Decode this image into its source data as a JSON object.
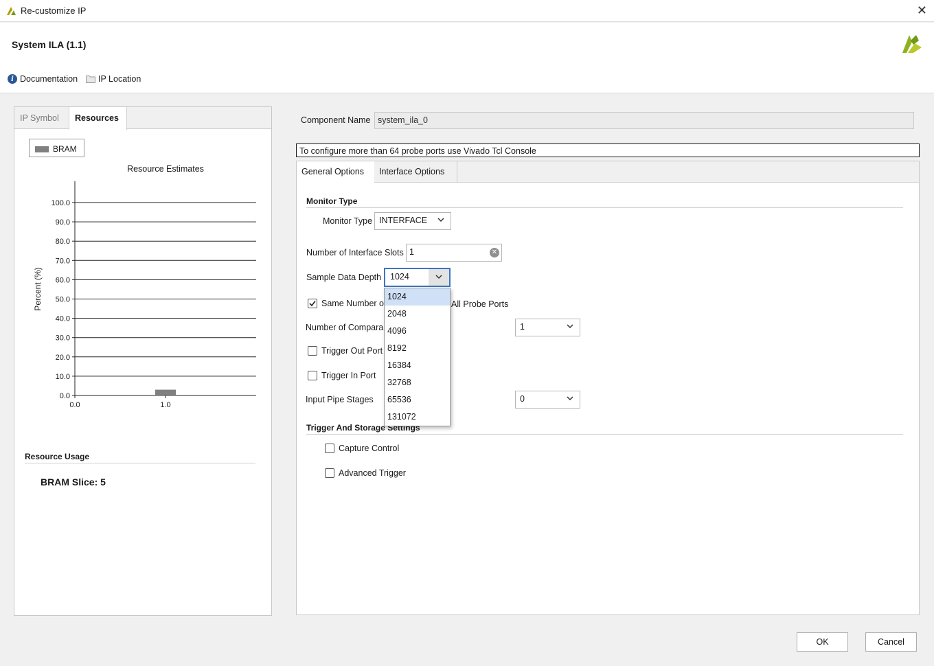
{
  "window": {
    "title": "Re-customize IP",
    "close_glyph": "✕"
  },
  "header": {
    "ip_title": "System ILA (1.1)",
    "links": [
      {
        "label": "Documentation",
        "icon": "info-icon"
      },
      {
        "label": "IP Location",
        "icon": "folder-icon"
      }
    ]
  },
  "left_panel": {
    "tabs": [
      {
        "label": "IP Symbol",
        "active": false
      },
      {
        "label": "Resources",
        "active": true
      }
    ],
    "legend": {
      "label": "BRAM",
      "color": "#808080"
    },
    "resource_usage": {
      "title": "Resource Usage",
      "items": [
        "BRAM Slice: 5"
      ]
    }
  },
  "chart_data": {
    "type": "bar",
    "title": "Resource Estimates",
    "ylabel": "Percent (%)",
    "xlabel": "",
    "categories": [
      "1.0"
    ],
    "series": [
      {
        "name": "BRAM",
        "x": [
          1.0
        ],
        "values": [
          3.0
        ],
        "color": "#808080"
      }
    ],
    "xlim": [
      0.0,
      2.0
    ],
    "ylim": [
      0.0,
      100.0
    ],
    "xticks": [
      "0.0",
      "1.0"
    ],
    "yticks": [
      "0.0",
      "10.0",
      "20.0",
      "30.0",
      "40.0",
      "50.0",
      "60.0",
      "70.0",
      "80.0",
      "90.0",
      "100.0"
    ],
    "grid": true,
    "legend": "top-left"
  },
  "component": {
    "label": "Component Name",
    "value": "system_ila_0"
  },
  "notice": "To configure more than 64 probe ports use Vivado Tcl Console",
  "right_panel": {
    "tabs": [
      {
        "label": "General Options",
        "active": true
      },
      {
        "label": "Interface Options",
        "active": false
      }
    ],
    "monitor_section": {
      "title": "Monitor Type",
      "monitor_type": {
        "label": "Monitor Type",
        "value": "INTERFACE"
      }
    },
    "interface_slots": {
      "label": "Number of Interface Slots",
      "value": "1"
    },
    "sample_depth": {
      "label": "Sample Data Depth",
      "value": "1024",
      "options": [
        "1024",
        "2048",
        "4096",
        "8192",
        "16384",
        "32768",
        "65536",
        "131072"
      ]
    },
    "same_comparators": {
      "label_visible_start": "Same Number o",
      "label_visible_end": "All Probe Ports",
      "checked": true
    },
    "comparators": {
      "label": "Number of Compara",
      "value": "1"
    },
    "trigger_out": {
      "label": "Trigger Out Port",
      "checked": false
    },
    "trigger_in": {
      "label": "Trigger In Port",
      "checked": false
    },
    "pipe_stages": {
      "label": "Input Pipe Stages",
      "value": "0"
    },
    "trigger_section": {
      "title": "Trigger And Storage Settings",
      "capture_control": {
        "label": "Capture Control",
        "checked": false
      },
      "advanced_trigger": {
        "label": "Advanced Trigger",
        "checked": false
      }
    }
  },
  "buttons": {
    "ok": "OK",
    "cancel": "Cancel"
  }
}
